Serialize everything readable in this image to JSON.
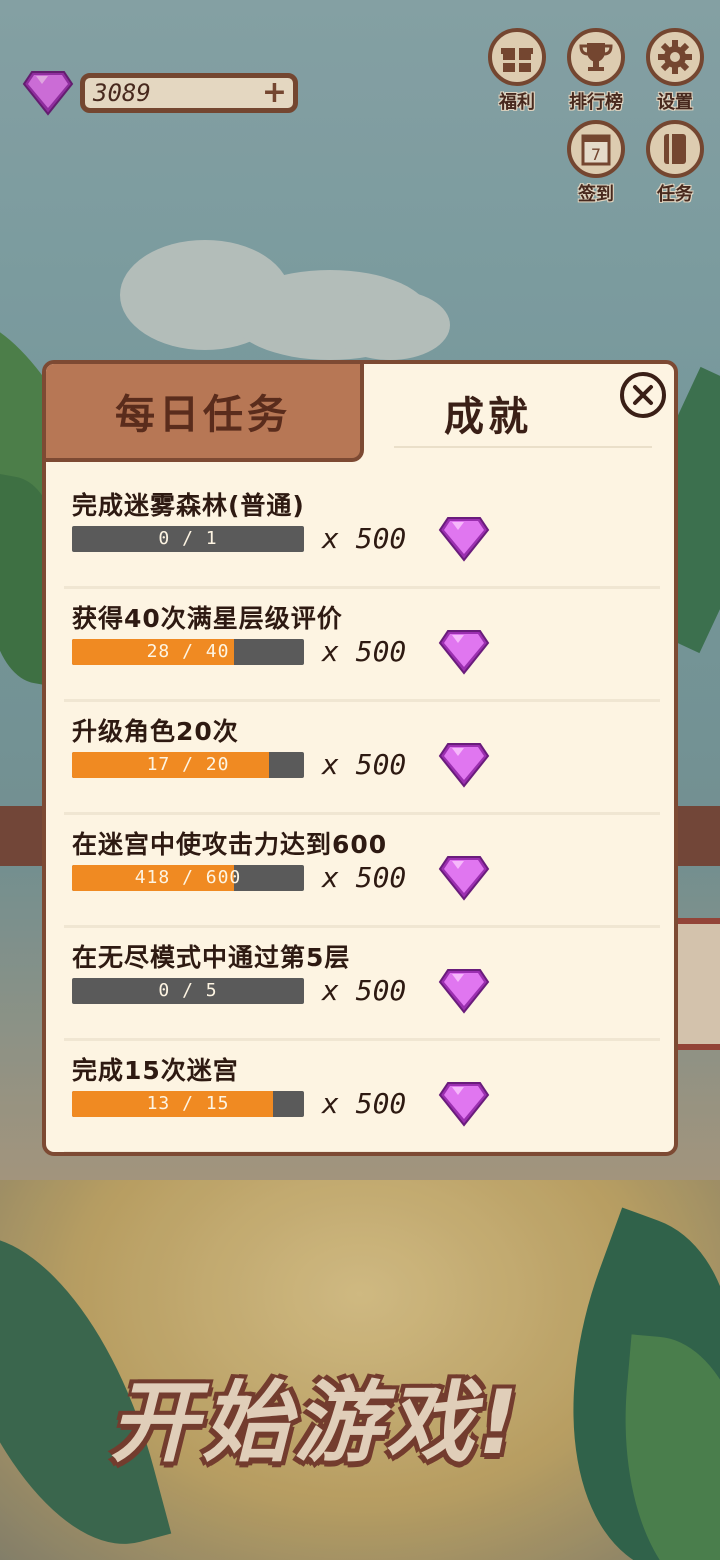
{
  "currency": {
    "value": "3089",
    "plus_label": "+",
    "icon": "gem-icon",
    "gem_color": "#d65ce6"
  },
  "hud": {
    "welfare": {
      "label": "福利",
      "icon": "gift-icon"
    },
    "leaderboard": {
      "label": "排行榜",
      "icon": "trophy-icon"
    },
    "settings": {
      "label": "设置",
      "icon": "gear-icon"
    },
    "checkin": {
      "label": "签到",
      "icon": "calendar-icon",
      "day": "7"
    },
    "tasks": {
      "label": "任务",
      "icon": "notebook-icon"
    }
  },
  "modal": {
    "tabs": [
      {
        "label": "每日任务",
        "active": true
      },
      {
        "label": "成就",
        "active": false
      }
    ],
    "close_icon": "close-icon",
    "tasks": [
      {
        "title": "完成迷雾森林(普通)",
        "progress_text": "0 / 1",
        "progress": 0,
        "reward": "x 500"
      },
      {
        "title": "获得40次满星层级评价",
        "progress_text": "28 / 40",
        "progress": 0.7,
        "reward": "x 500"
      },
      {
        "title": "升级角色20次",
        "progress_text": "17 / 20",
        "progress": 0.85,
        "reward": "x 500"
      },
      {
        "title": "在迷宫中使攻击力达到600",
        "progress_text": "418 / 600",
        "progress": 0.697,
        "reward": "x 500"
      },
      {
        "title": "在无尽模式中通过第5层",
        "progress_text": "0 / 5",
        "progress": 0,
        "reward": "x 500"
      },
      {
        "title": "完成15次迷宫",
        "progress_text": "13 / 15",
        "progress": 0.867,
        "reward": "x 500"
      }
    ]
  },
  "start_button": {
    "label": "开始游戏!"
  },
  "colors": {
    "brown": "#7d4a33",
    "panel": "#fdf4e2",
    "progress_fill": "#f08a22",
    "progress_track": "#5a5a5a"
  }
}
